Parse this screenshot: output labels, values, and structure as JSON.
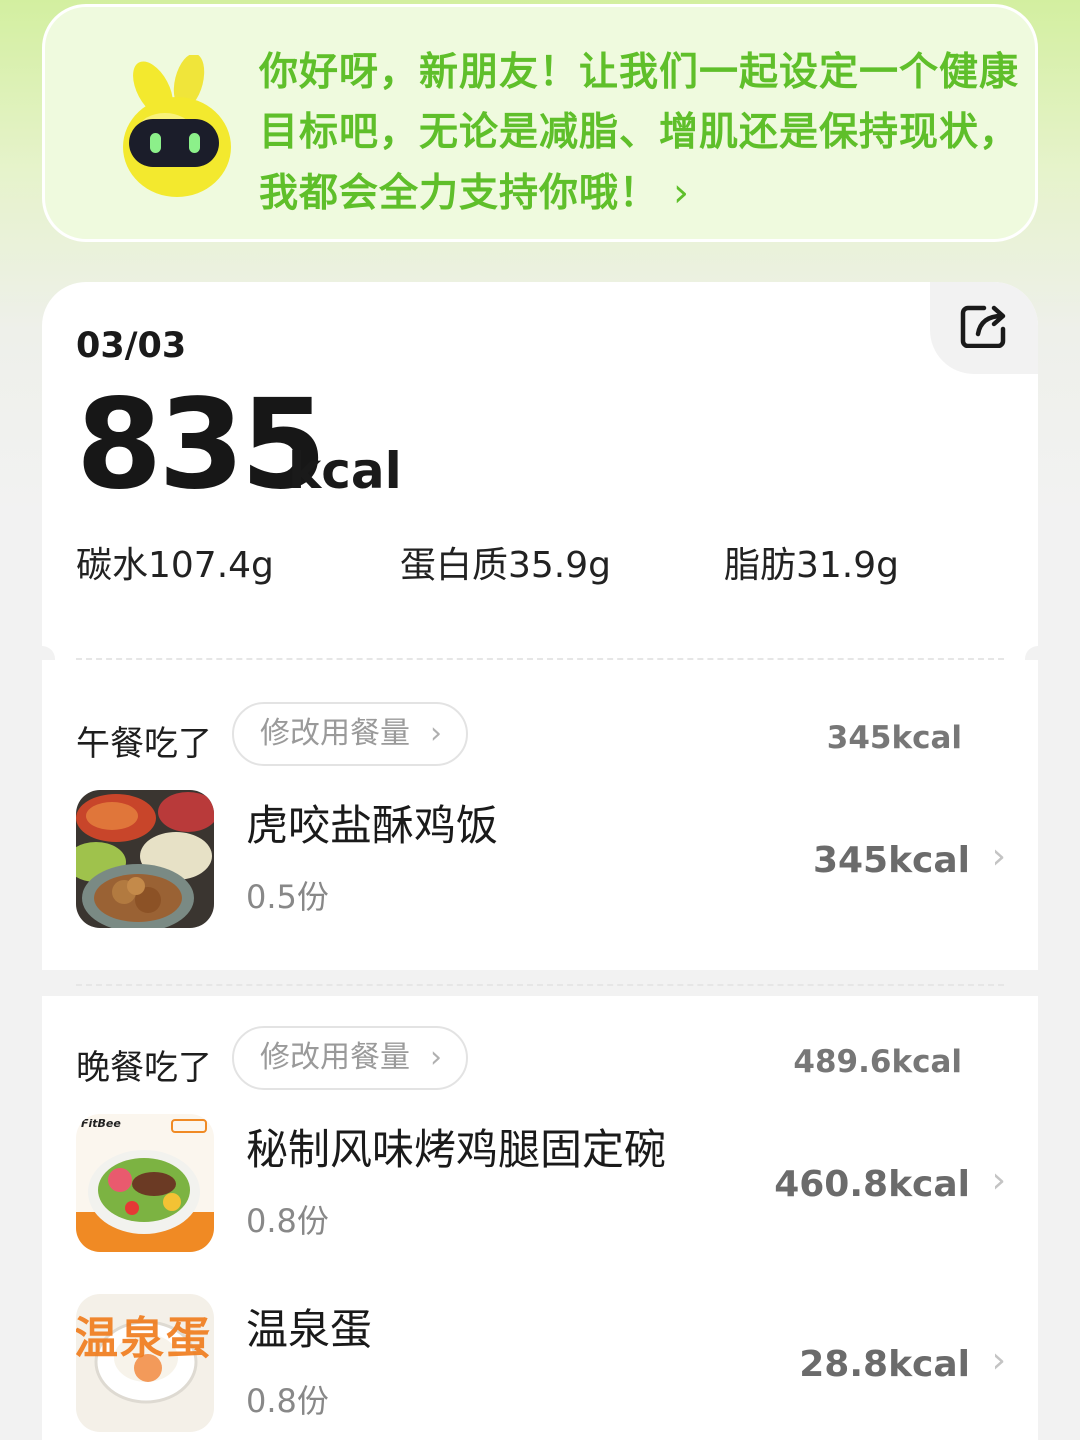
{
  "greeting": {
    "text": "你好呀，新朋友！让我们一起设定一个健康目标吧，无论是减脂、增肌还是保持现状，我都会全力支持你哦！",
    "chevron": "›",
    "mascot_icon": "robot-mascot-icon"
  },
  "summary": {
    "date": "03/03",
    "kcal_value": "835",
    "kcal_unit": "kcal",
    "share_icon": "share-icon",
    "macros": {
      "carbs": "碳水107.4g",
      "protein": "蛋白质35.9g",
      "fat": "脂肪31.9g"
    }
  },
  "meals": [
    {
      "title": "午餐吃了",
      "edit_label": "修改用餐量",
      "edit_chevron": "›",
      "total": "345kcal",
      "items": [
        {
          "name": "虎咬盐酥鸡饭",
          "portion": "0.5份",
          "kcal": "345kcal",
          "chevron": "›"
        }
      ]
    },
    {
      "title": "晚餐吃了",
      "edit_label": "修改用餐量",
      "edit_chevron": "›",
      "total": "489.6kcal",
      "items": [
        {
          "name": "秘制风味烤鸡腿固定碗",
          "portion": "0.8份",
          "kcal": "460.8kcal",
          "chevron": "›",
          "img_brand": "FitBee"
        },
        {
          "name": "温泉蛋",
          "portion": "0.8份",
          "kcal": "28.8kcal",
          "chevron": "›",
          "img_text": "温泉蛋"
        }
      ]
    }
  ],
  "colors": {
    "accent_green": "#5fbf2a",
    "banner_bg": "#effade",
    "mascot_yellow": "#f3e92e"
  }
}
